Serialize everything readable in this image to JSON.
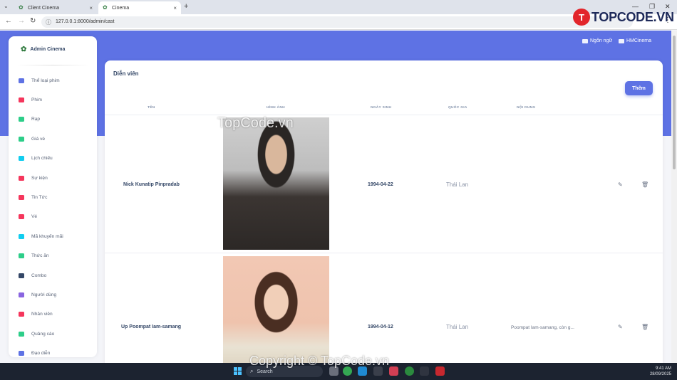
{
  "browser": {
    "tabs": [
      {
        "title": "Client Cinema",
        "close": "×"
      },
      {
        "title": "Cinema",
        "close": "×"
      }
    ],
    "new_tab": "+",
    "tab_menu": "⌄",
    "window_controls": {
      "minimize": "—",
      "restore": "❐",
      "close": "✕"
    },
    "nav": {
      "back": "←",
      "forward": "→",
      "reload": "↻"
    },
    "url": "127.0.0.1:8000/admin/cast",
    "menu": "⋮"
  },
  "topnav": {
    "language": "Ngôn ngữ",
    "account": "HMCinema"
  },
  "sidebar": {
    "brand": "Admin Cinema",
    "items": [
      {
        "label": "Thể loại phim",
        "color": "#5e72e4"
      },
      {
        "label": "Phim",
        "color": "#f5365c"
      },
      {
        "label": "Rạp",
        "color": "#2dce89"
      },
      {
        "label": "Giá vé",
        "color": "#2dce89"
      },
      {
        "label": "Lịch chiếu",
        "color": "#11cdef"
      },
      {
        "label": "Sự kiện",
        "color": "#f5365c"
      },
      {
        "label": "Tin Tức",
        "color": "#f5365c"
      },
      {
        "label": "Vé",
        "color": "#f5365c"
      },
      {
        "label": "Mã khuyến mãi",
        "color": "#11cdef"
      },
      {
        "label": "Thức ăn",
        "color": "#2dce89"
      },
      {
        "label": "Combo",
        "color": "#344767"
      },
      {
        "label": "Người dùng",
        "color": "#8965e0"
      },
      {
        "label": "Nhân viên",
        "color": "#f5365c"
      },
      {
        "label": "Quảng cáo",
        "color": "#2dce89"
      },
      {
        "label": "Đạo diễn",
        "color": "#5e72e4"
      }
    ]
  },
  "card": {
    "title": "Diễn viên",
    "add_label": "Thêm",
    "columns": [
      "TÊN",
      "HÌNH ẢNH",
      "NGÀY SINH",
      "QUỐC GIA",
      "NỘI DUNG"
    ],
    "rows": [
      {
        "name": "Nick Kunatip Pinpradab",
        "birth": "1994-04-22",
        "country": "Thái Lan",
        "content": ""
      },
      {
        "name": "Up Poompat Iam-samang",
        "birth": "1994-04-12",
        "country": "Thái Lan",
        "content": "Poompat Iam-samang, còn g..."
      }
    ],
    "edit_icon": "✎",
    "delete_icon": "🗑"
  },
  "taskbar": {
    "search_placeholder": "Search",
    "time": "9:41 AM",
    "date": "28/09/2025"
  },
  "watermarks": {
    "logo": "TOPCODE.VN",
    "logo_mark": "T",
    "text": "TopCode.vn",
    "copyright": "Copyright © TopCode.vn"
  }
}
